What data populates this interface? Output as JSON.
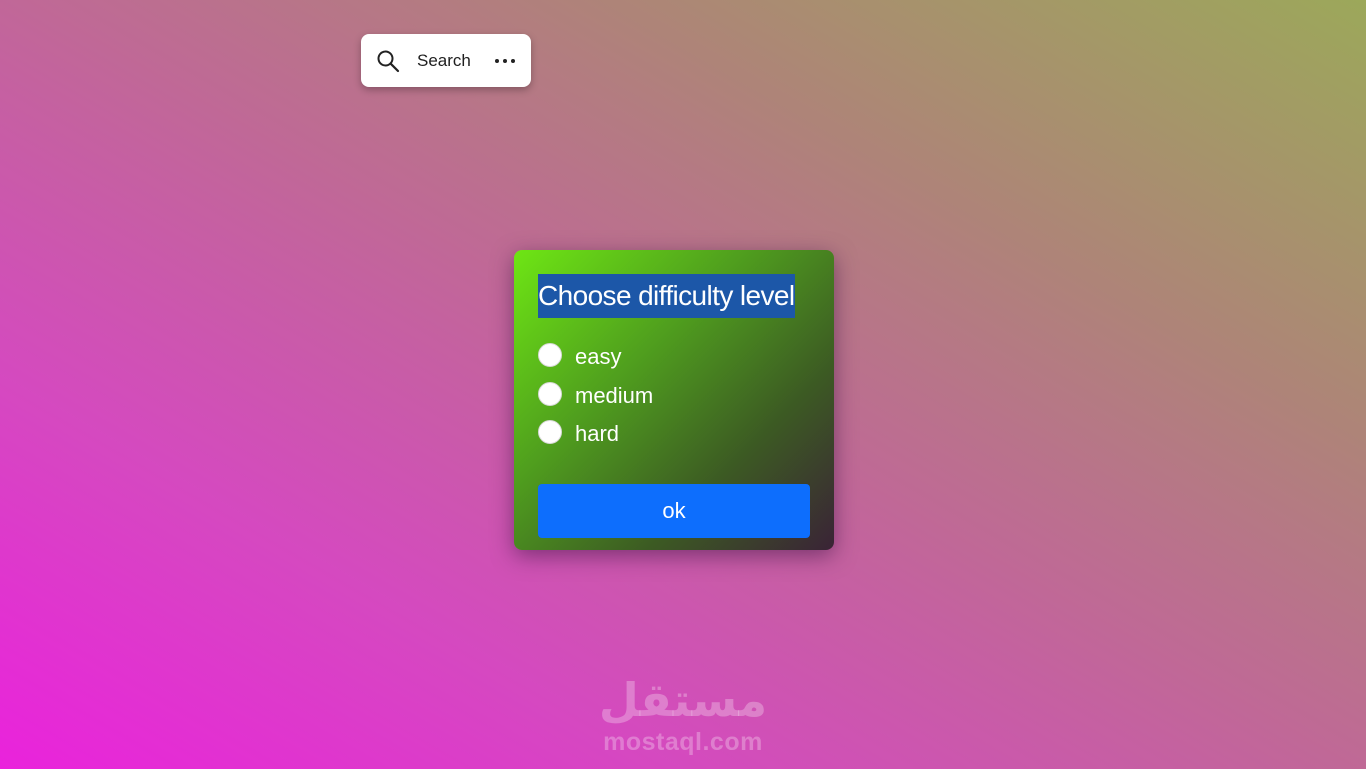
{
  "search_bar": {
    "label": "Search",
    "icon": "search-icon",
    "more_icon": "more-horizontal-icon"
  },
  "dialog": {
    "title": "Choose difficulty level",
    "options": [
      {
        "label": "easy",
        "selected": false
      },
      {
        "label": "medium",
        "selected": false
      },
      {
        "label": "hard",
        "selected": false
      }
    ],
    "ok_label": "ok"
  },
  "watermark": {
    "logo_text": "مستقل",
    "url": "mostaql.com"
  },
  "colors": {
    "background_from": "#ea22dc",
    "background_to": "#9ca85a",
    "dialog_from": "#6ee614",
    "dialog_to": "#3a2336",
    "title_highlight": "#1c57a8",
    "button": "#0d6efd"
  }
}
